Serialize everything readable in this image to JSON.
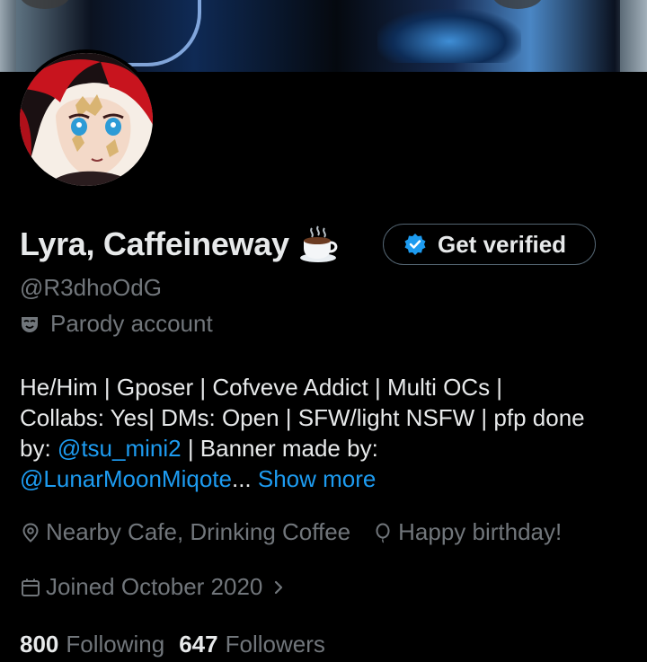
{
  "profile": {
    "display_name": "Lyra, Caffeineway",
    "name_emoji": "coffee-cup-icon",
    "handle": "@R3dhoOdG",
    "parody_label": "Parody account",
    "get_verified_label": "Get verified"
  },
  "bio": {
    "line1": "He/Him | Gposer | Cofveve Addict | Multi OCs |",
    "line2": "Collabs: Yes| DMs: Open | SFW/light NSFW | pfp done",
    "line3_prefix": "by: ",
    "mention1": "@tsu_mini2",
    "line3_suffix": " | Banner made by:",
    "mention2": "@LunarMoonMiqote",
    "ellipsis": "...",
    "show_more": "Show more"
  },
  "meta": {
    "location": "Nearby Cafe, Drinking Coffee",
    "birthday": "Happy birthday!",
    "joined": "Joined October 2020"
  },
  "stats": {
    "following_count": "800",
    "following_label": "Following",
    "followers_count": "647",
    "followers_label": "Followers"
  },
  "colors": {
    "background": "#000000",
    "text_primary": "#e7e9ea",
    "text_secondary": "#71767b",
    "link": "#1d9bf0",
    "verified_badge": "#1d9bf0"
  }
}
